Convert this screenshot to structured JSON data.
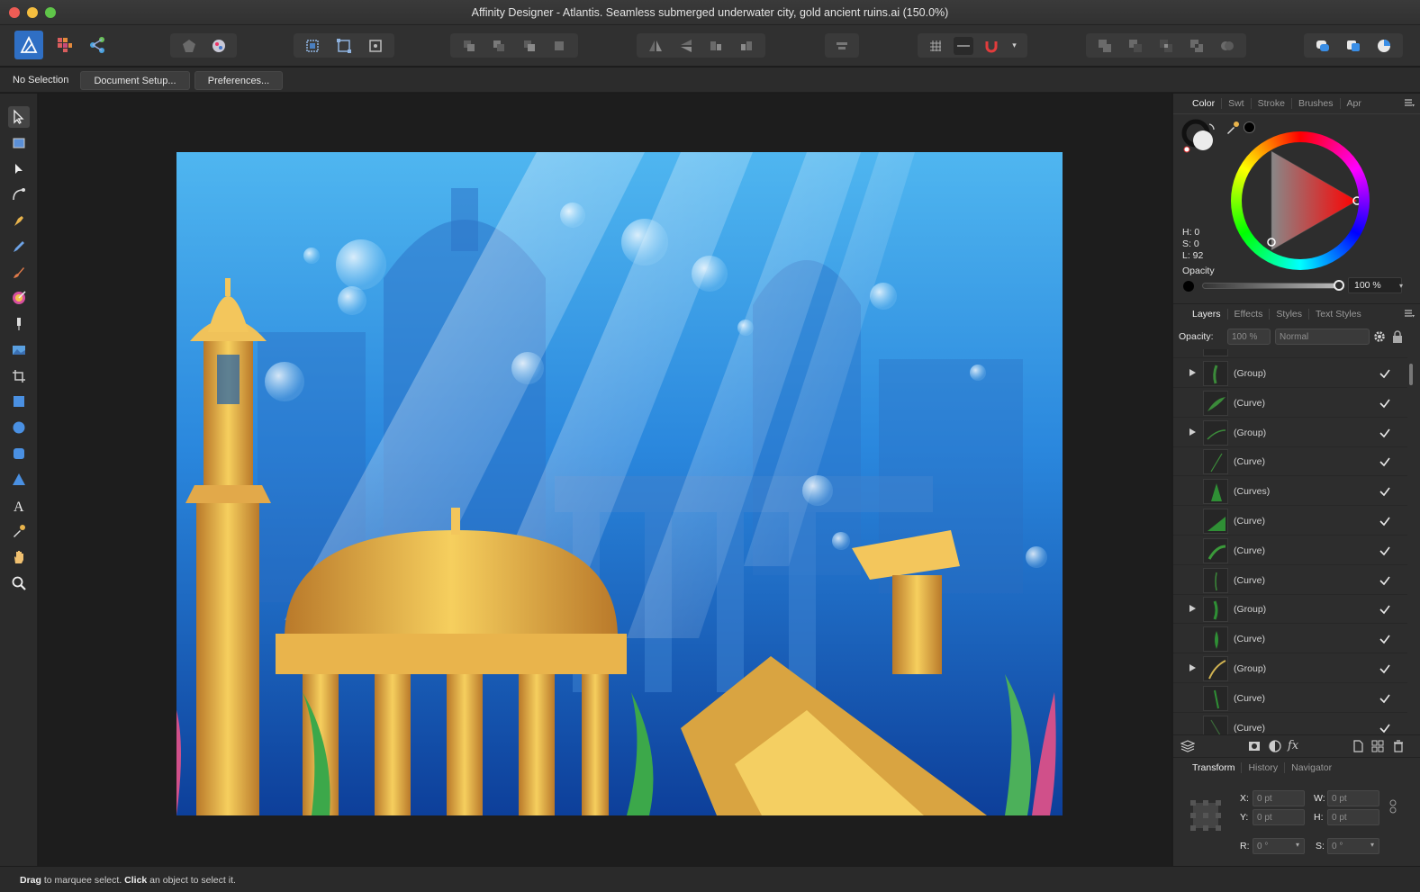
{
  "window": {
    "title": "Affinity Designer - Atlantis. Seamless submerged underwater city, gold ancient ruins.ai (150.0%)"
  },
  "toolbar": {
    "personas": [
      "designer-persona-icon",
      "pixel-persona-icon",
      "export-persona-icon"
    ],
    "snapping_dropdown": "▾"
  },
  "context": {
    "selection_label": "No Selection",
    "document_setup": "Document Setup...",
    "preferences": "Preferences..."
  },
  "tools": [
    "move-tool-icon",
    "artboard-tool-icon",
    "node-tool-icon",
    "corner-tool-icon",
    "pen-tool-icon",
    "pencil-tool-icon",
    "vector-brush-tool-icon",
    "fill-tool-icon",
    "transparency-tool-icon",
    "place-image-tool-icon",
    "crop-tool-icon",
    "rectangle-tool-icon",
    "ellipse-tool-icon",
    "rounded-rectangle-tool-icon",
    "triangle-tool-icon",
    "text-tool-icon",
    "color-picker-tool-icon",
    "view-tool-icon",
    "zoom-tool-icon"
  ],
  "color_panel": {
    "tabs": [
      "Color",
      "Swt",
      "Stroke",
      "Brushes",
      "Apr"
    ],
    "active_tab": "Color",
    "h": "H: 0",
    "s": "S: 0",
    "l": "L: 92",
    "opacity_label": "Opacity",
    "opacity_value": "100 %"
  },
  "layers_panel": {
    "tabs": [
      "Layers",
      "Effects",
      "Styles",
      "Text Styles"
    ],
    "active_tab": "Layers",
    "opacity_label": "Opacity:",
    "opacity_value": "100 %",
    "blend_mode": "Normal",
    "rows": [
      {
        "name": "(Group)",
        "expandable": true
      },
      {
        "name": "(Curve)",
        "expandable": false
      },
      {
        "name": "(Group)",
        "expandable": true
      },
      {
        "name": "(Curve)",
        "expandable": false
      },
      {
        "name": "(Curves)",
        "expandable": false
      },
      {
        "name": "(Curve)",
        "expandable": false
      },
      {
        "name": "(Curve)",
        "expandable": false
      },
      {
        "name": "(Curve)",
        "expandable": false
      },
      {
        "name": "(Group)",
        "expandable": true
      },
      {
        "name": "(Curve)",
        "expandable": false
      },
      {
        "name": "(Group)",
        "expandable": true
      },
      {
        "name": "(Curve)",
        "expandable": false
      },
      {
        "name": "(Curve)",
        "expandable": false
      }
    ]
  },
  "transform_panel": {
    "tabs": [
      "Transform",
      "History",
      "Navigator"
    ],
    "active_tab": "Transform",
    "x_label": "X:",
    "x_value": "0 pt",
    "y_label": "Y:",
    "y_value": "0 pt",
    "w_label": "W:",
    "w_value": "0 pt",
    "h_label": "H:",
    "h_value": "0 pt",
    "r_label": "R:",
    "r_value": "0 °",
    "s_label": "S:",
    "s_value": "0 °"
  },
  "status": {
    "drag": "Drag",
    "text1": " to marquee select. ",
    "click": "Click",
    "text2": " an object to select it."
  },
  "colors": {
    "accent": "#3a8ee6",
    "magnet": "#e23c3c",
    "gold": "#e8b64a",
    "water_light": "#8fd8ff",
    "water_dark": "#0d3f9a"
  }
}
